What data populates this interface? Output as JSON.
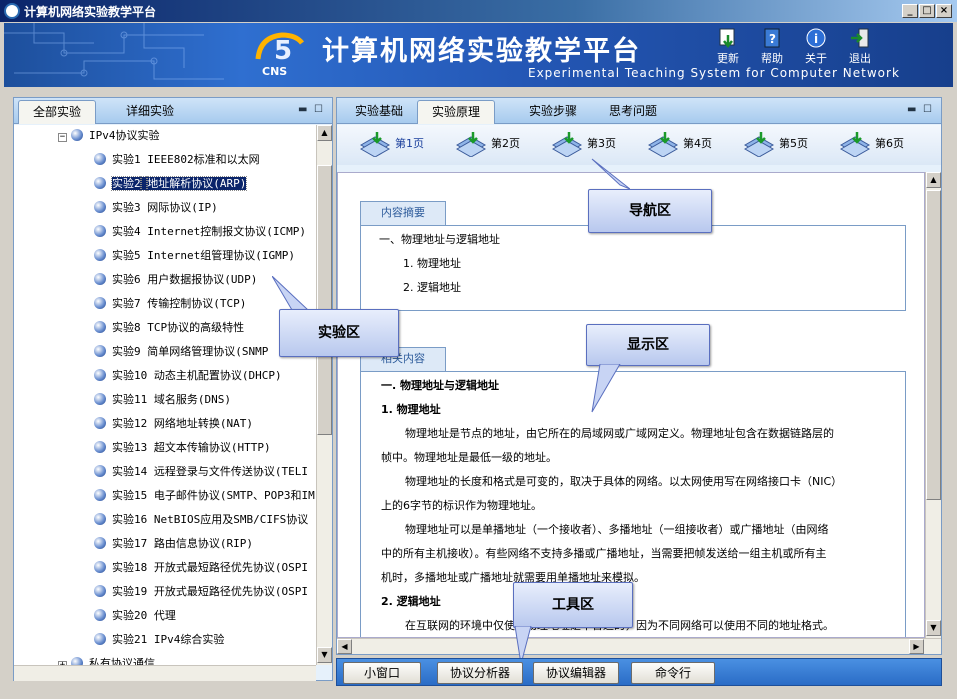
{
  "window": {
    "title": "计算机网络实验教学平台",
    "buttons": [
      "_",
      "□",
      "×"
    ]
  },
  "banner": {
    "title": "计算机网络实验教学平台",
    "subtitle": "Experimental Teaching System for Computer Network",
    "logo_text": "CNS",
    "logo_digit": "5",
    "toolbar": [
      {
        "label": "更新",
        "icon": "update-icon"
      },
      {
        "label": "帮助",
        "icon": "help-icon"
      },
      {
        "label": "关于",
        "icon": "info-icon"
      },
      {
        "label": "退出",
        "icon": "exit-icon"
      }
    ]
  },
  "left_panel": {
    "tabs": [
      "全部实验",
      "详细实验"
    ],
    "active_tab": "全部实验",
    "tree_root": "IPv4协议实验",
    "items": [
      {
        "num": "实验1",
        "name": "IEEE802标准和以太网"
      },
      {
        "num": "实验2",
        "name": "地址解析协议(ARP)"
      },
      {
        "num": "实验3",
        "name": "网际协议(IP)"
      },
      {
        "num": "实验4",
        "name": "Internet控制报文协议(ICMP)"
      },
      {
        "num": "实验5",
        "name": "Internet组管理协议(IGMP)"
      },
      {
        "num": "实验6",
        "name": "用户数据报协议(UDP)"
      },
      {
        "num": "实验7",
        "name": "传输控制协议(TCP)"
      },
      {
        "num": "实验8",
        "name": "TCP协议的高级特性"
      },
      {
        "num": "实验9",
        "name": "简单网络管理协议(SNMP"
      },
      {
        "num": "实验10",
        "name": "动态主机配置协议(DHCP)"
      },
      {
        "num": "实验11",
        "name": "域名服务(DNS)"
      },
      {
        "num": "实验12",
        "name": "网络地址转换(NAT)"
      },
      {
        "num": "实验13",
        "name": "超文本传输协议(HTTP)"
      },
      {
        "num": "实验14",
        "name": "远程登录与文件传送协议(TELI"
      },
      {
        "num": "实验15",
        "name": "电子邮件协议(SMTP、POP3和IM"
      },
      {
        "num": "实验16",
        "name": "NetBIOS应用及SMB/CIFS协议"
      },
      {
        "num": "实验17",
        "name": "路由信息协议(RIP)"
      },
      {
        "num": "实验18",
        "name": "开放式最短路径优先协议(OSPI"
      },
      {
        "num": "实验19",
        "name": "开放式最短路径优先协议(OSPI"
      },
      {
        "num": "实验20",
        "name": "代理"
      },
      {
        "num": "实验21",
        "name": "IPv4综合实验"
      }
    ],
    "selected_index": 1,
    "next_root": "私有协议通信"
  },
  "right_panel": {
    "tabs": [
      "实验基础",
      "实验原理",
      "实验步骤",
      "思考问题"
    ],
    "active_tab": "实验原理",
    "pages": [
      "第1页",
      "第2页",
      "第3页",
      "第4页",
      "第5页",
      "第6页"
    ],
    "active_page": "第1页",
    "summary": {
      "tab": "内容摘要",
      "lines": [
        "一、物理地址与逻辑地址",
        "1.   物理地址",
        "2.   逻辑地址"
      ]
    },
    "content": {
      "tab": "相关内容",
      "heading": "一.  物理地址与逻辑地址",
      "sub1": "1.   物理地址",
      "paras": [
        "物理地址是节点的地址，由它所在的局域网或广域网定义。物理地址包含在数据链路层的",
        "帧中。物理地址是最低一级的地址。",
        "物理地址的长度和格式是可变的，取决于具体的网络。以太网使用写在网络接口卡（NIC）",
        "上的6字节的标识作为物理地址。",
        "物理地址可以是单播地址（一个接收者）、多播地址（一组接收者）或广播地址（由网络",
        "中的所有主机接收）。有些网络不支持多播或广播地址，当需要把帧发送给一组主机或所有主",
        "机时，多播地址或广播地址就需要用单播地址来模拟。"
      ],
      "sub2": "2.   逻辑地址",
      "last": "在互联网的环境中仅使用物理地址是不合适的，因为不同网络可以使用不同的地址格式。"
    }
  },
  "callouts": {
    "nav": "导航区",
    "exp": "实验区",
    "display": "显示区",
    "tool": "工具区"
  },
  "bottom_toolbar": [
    "小窗口",
    "协议分析器",
    "协议编辑器",
    "命令行"
  ]
}
